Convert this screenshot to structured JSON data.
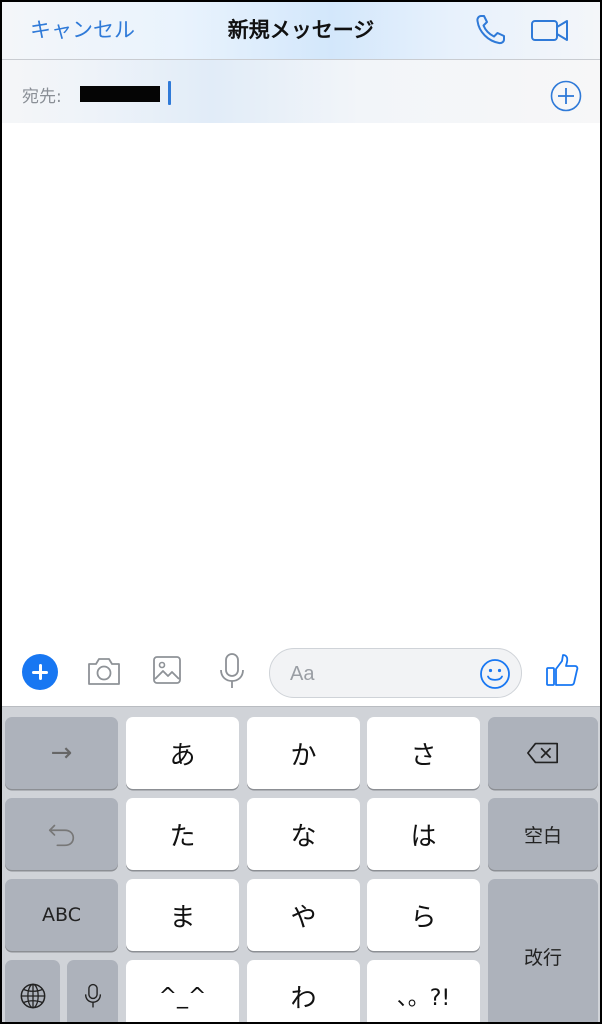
{
  "header": {
    "cancel_label": "キャンセル",
    "title": "新規メッセージ",
    "icons": [
      "phone-icon",
      "video-camera-icon"
    ]
  },
  "recipient": {
    "label": "宛先:",
    "chip_redacted": true,
    "value": "",
    "add_icon": "plus-circle-icon"
  },
  "composer": {
    "icons": [
      "plus-icon",
      "camera-icon",
      "image-icon",
      "microphone-icon",
      "smiley-icon",
      "thumbs-up-icon"
    ],
    "placeholder": "Aa"
  },
  "keyboard": {
    "row1": {
      "left": "→",
      "keys": [
        "あ",
        "か",
        "さ"
      ],
      "right_icon": "backspace-icon"
    },
    "row2": {
      "left_icon": "undo-icon",
      "keys": [
        "た",
        "な",
        "は"
      ],
      "right": "空白"
    },
    "row3": {
      "left": "ABC",
      "keys": [
        "ま",
        "や",
        "ら"
      ],
      "right": "改行"
    },
    "row4": {
      "left_icons": [
        "globe-icon",
        "microphone-icon"
      ],
      "keys": [
        "^_^",
        "わ",
        "、。?!"
      ]
    }
  },
  "colors": {
    "accent": "#2f7ad8",
    "brand_blue": "#1877f2",
    "keyboard_bg": "#d0d3d8",
    "dark_key": "#adb2bb"
  }
}
